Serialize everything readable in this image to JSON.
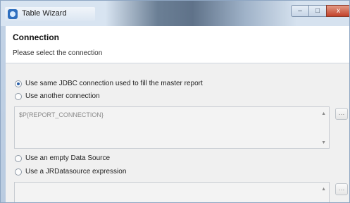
{
  "window": {
    "title": "Table Wizard",
    "controls": {
      "minimize": "–",
      "maximize": "□",
      "close": "x"
    }
  },
  "header": {
    "title": "Connection",
    "subtitle": "Please select the connection"
  },
  "options": {
    "same_jdbc": "Use same JDBC connection used to fill the master report",
    "another_connection": "Use another connection",
    "connection_expression": "$P{REPORT_CONNECTION}",
    "empty_datasource": "Use an empty Data Source",
    "jrdatasource_expression": "Use a JRDatasource expression",
    "selected": "same_jdbc"
  },
  "icons": {
    "app": "table-wizard-icon",
    "scroll_up": "▲",
    "scroll_down": "▼",
    "expression_button": "…"
  },
  "colors": {
    "accent": "#2a5fa8",
    "close": "#c2412a"
  }
}
